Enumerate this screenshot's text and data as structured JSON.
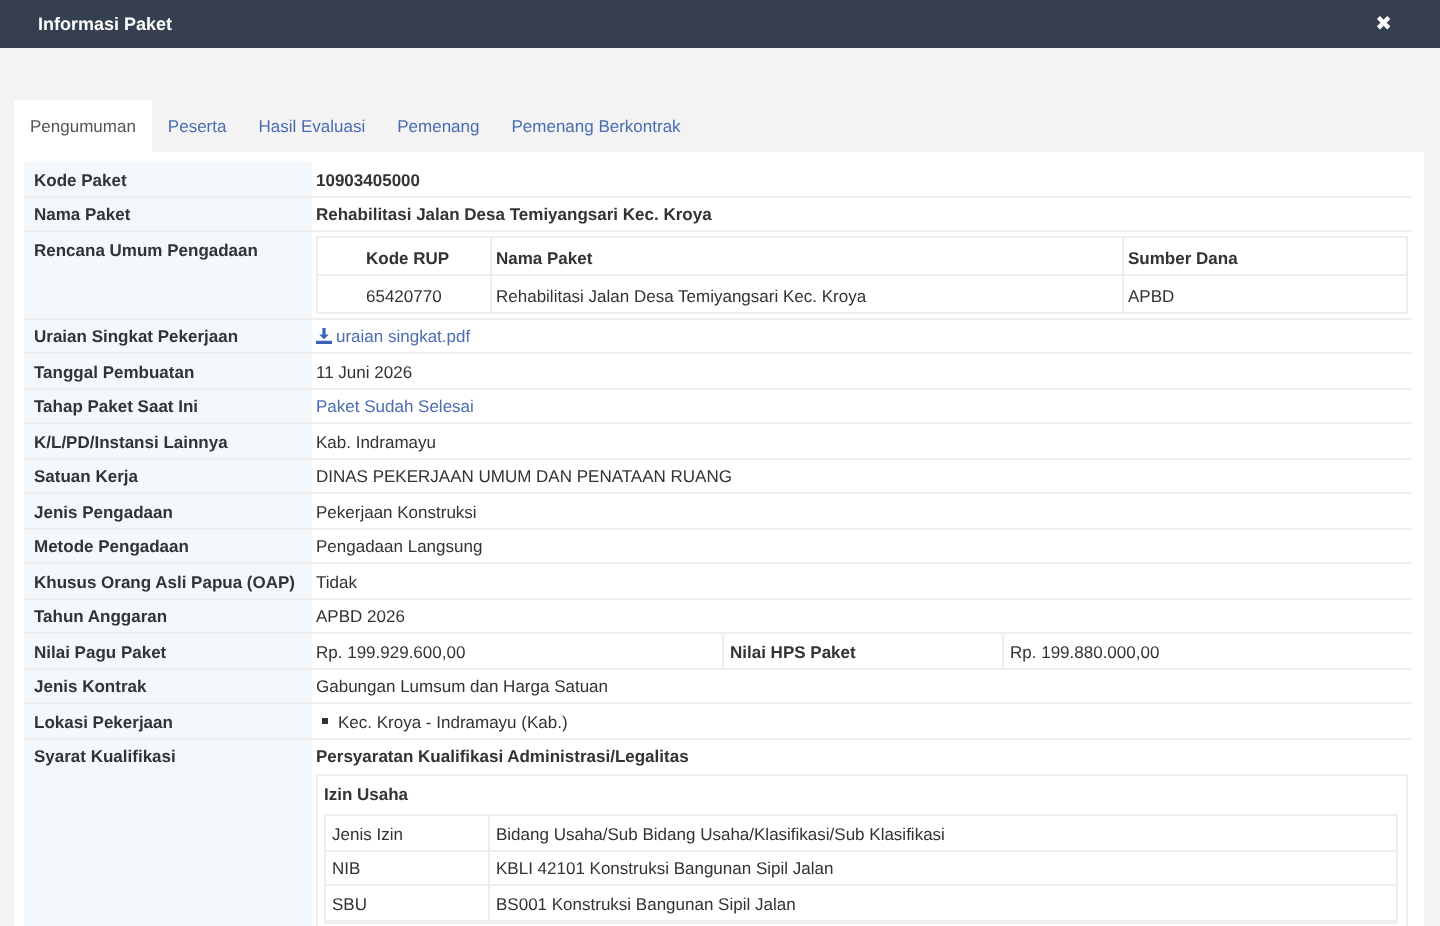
{
  "window": {
    "title": "Informasi Paket",
    "close": "✖"
  },
  "tabs": [
    {
      "label": "Pengumuman",
      "selected": true
    },
    {
      "label": "Peserta",
      "selected": false
    },
    {
      "label": "Hasil Evaluasi",
      "selected": false
    },
    {
      "label": "Pemenang",
      "selected": false
    },
    {
      "label": "Pemenang Berkontrak",
      "selected": false
    }
  ],
  "rows": [
    {
      "kind": "text",
      "label": "Kode Paket",
      "value": "10903405000",
      "bold": true
    },
    {
      "kind": "text",
      "label": "Nama Paket",
      "value": "Rehabilitasi Jalan Desa Temiyangsari Kec. Kroya",
      "bold": true
    },
    {
      "kind": "table",
      "label": "Rencana Umum Pengadaan",
      "columns": [
        "Kode RUP",
        "Nama Paket",
        "Sumber Dana"
      ],
      "rows": [
        [
          "65420770",
          "Rehabilitasi Jalan Desa Temiyangsari Kec. Kroya",
          "APBD"
        ]
      ]
    },
    {
      "kind": "file",
      "label": "Uraian Singkat Pekerjaan",
      "value": "uraian singkat.pdf"
    },
    {
      "kind": "text",
      "label": "Tanggal Pembuatan",
      "value": "11 Juni 2026",
      "bold": false
    },
    {
      "kind": "link",
      "label": "Tahap Paket Saat Ini",
      "value": "Paket Sudah Selesai"
    },
    {
      "kind": "text",
      "label": "K/L/PD/Instansi Lainnya",
      "value": "Kab. Indramayu",
      "bold": false
    },
    {
      "kind": "text",
      "label": "Satuan Kerja",
      "value": "DINAS PEKERJAAN UMUM DAN PENATAAN RUANG",
      "bold": false
    },
    {
      "kind": "text",
      "label": "Jenis Pengadaan",
      "value": "Pekerjaan Konstruksi",
      "bold": false
    },
    {
      "kind": "text",
      "label": "Metode Pengadaan",
      "value": "Pengadaan Langsung",
      "bold": false
    },
    {
      "kind": "text",
      "label": "Khusus Orang Asli Papua (OAP)",
      "value": "Tidak",
      "bold": false
    },
    {
      "kind": "text",
      "label": "Tahun Anggaran",
      "value": "APBD 2026",
      "bold": false
    },
    {
      "kind": "pair",
      "label": "Nilai Pagu Paket",
      "value": "Rp. 199.929.600,00",
      "label2": "Nilai HPS Paket",
      "value2": "Rp. 199.880.000,00"
    },
    {
      "kind": "text",
      "label": "Jenis Kontrak",
      "value": "Gabungan Lumsum dan Harga Satuan",
      "bold": false
    },
    {
      "kind": "list",
      "label": "Lokasi Pekerjaan",
      "items": [
        "Kec. Kroya - Indramayu (Kab.)"
      ]
    },
    {
      "kind": "syarat",
      "label": "Syarat Kualifikasi",
      "heading": "Persyaratan Kualifikasi Administrasi/Legalitas",
      "section": "Izin Usaha",
      "rows": [
        [
          "Jenis Izin",
          "Bidang Usaha/Sub Bidang Usaha/Klasifikasi/Sub Klasifikasi"
        ],
        [
          "NIB",
          "KBLI 42101 Konstruksi Bangunan Sipil Jalan"
        ],
        [
          "SBU",
          "BS001 Konstruksi Bangunan Sipil Jalan"
        ]
      ]
    }
  ]
}
